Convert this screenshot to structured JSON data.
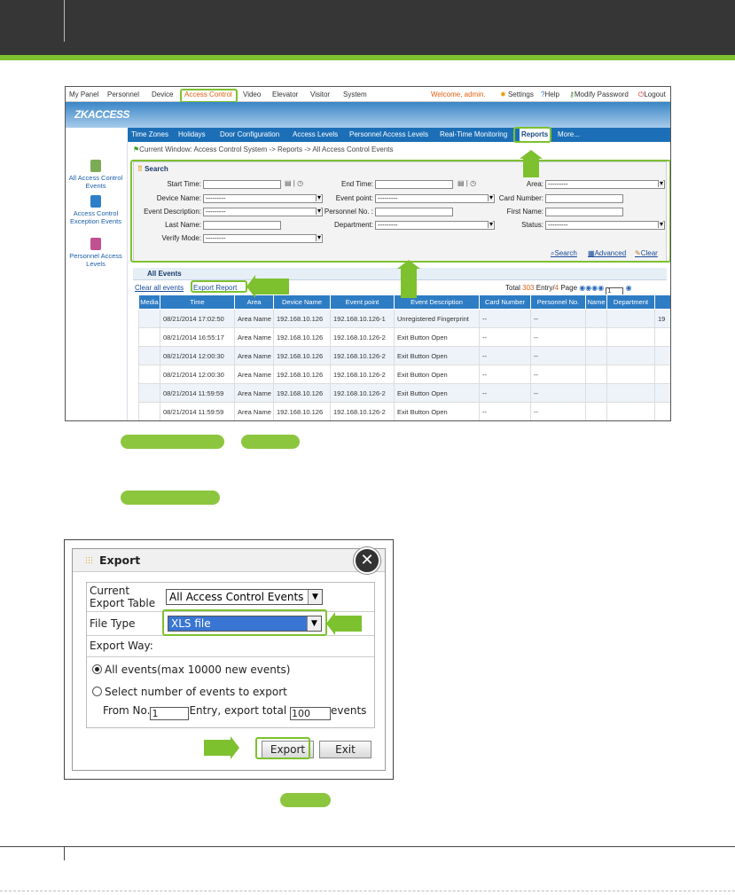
{
  "menubar": {
    "items": [
      "My Panel",
      "Personnel",
      "Device",
      "Access Control",
      "Video",
      "Elevator",
      "Visitor",
      "System"
    ],
    "welcome": "Welcome, admin.",
    "settings": "Settings",
    "help": "Help",
    "modify_password": "Modify Password",
    "logout": "Logout"
  },
  "logo": "ZKACCESS",
  "subnav": [
    "Time Zones",
    "Holidays",
    "Door Configuration",
    "Access Levels",
    "Personnel Access Levels",
    "Real-Time Monitoring",
    "Reports",
    "More..."
  ],
  "leftnav": [
    "All Access Control Events",
    "Access Control Exception Events",
    "Personnel Access Levels"
  ],
  "breadcrumb": "Current Window: Access Control System -> Reports -> All Access Control Events",
  "search": {
    "title": "Search",
    "start_time": "Start Time:",
    "end_time": "End Time:",
    "area": "Area:",
    "area_val": "---------",
    "device_name": "Device Name:",
    "device_val": "---------",
    "event_point": "Event point:",
    "event_point_val": "---------",
    "card_number": "Card Number:",
    "event_description": "Event Description:",
    "event_description_val": "---------",
    "personnel_no": "Personnel No. :",
    "first_name": "First Name:",
    "last_name": "Last Name:",
    "department": "Department:",
    "department_val": "---------",
    "status": "Status:",
    "status_val": "---------",
    "verify_mode": "Verify Mode:",
    "verify_val": "---------",
    "search_link": "Search",
    "advanced_link": "Advanced",
    "clear_link": "Clear"
  },
  "events": {
    "title": "All Events",
    "clear_all": "Clear all events",
    "export_report": "Export Report",
    "total_prefix": "Total",
    "total": "303",
    "entry_text": "Entry/",
    "pages": "4",
    "page_text": "Page",
    "page_no": "1",
    "columns": [
      "Media",
      "Time",
      "Area",
      "Device Name",
      "Event point",
      "Event Description",
      "Card Number",
      "Personnel No.",
      "Name",
      "Department",
      ""
    ],
    "rows": [
      [
        "",
        "08/21/2014 17:02:50",
        "Area Name",
        "192.168.10.126",
        "192.168.10.126-1",
        "Unregistered Fingerprint",
        "--",
        "--",
        "",
        "",
        "19"
      ],
      [
        "",
        "08/21/2014 16:55:17",
        "Area Name",
        "192.168.10.126",
        "192.168.10.126-2",
        "Exit Button Open",
        "--",
        "--",
        "",
        "",
        ""
      ],
      [
        "",
        "08/21/2014 12:00:30",
        "Area Name",
        "192.168.10.126",
        "192.168.10.126-2",
        "Exit Button Open",
        "--",
        "--",
        "",
        "",
        ""
      ],
      [
        "",
        "08/21/2014 12:00:30",
        "Area Name",
        "192.168.10.126",
        "192.168.10.126-2",
        "Exit Button Open",
        "--",
        "--",
        "",
        "",
        ""
      ],
      [
        "",
        "08/21/2014 11:59:59",
        "Area Name",
        "192.168.10.126",
        "192.168.10.126-2",
        "Exit Button Open",
        "--",
        "--",
        "",
        "",
        ""
      ],
      [
        "",
        "08/21/2014 11:59:59",
        "Area Name",
        "192.168.10.126",
        "192.168.10.126-2",
        "Exit Button Open",
        "--",
        "--",
        "",
        "",
        ""
      ]
    ]
  },
  "export_dialog": {
    "title": "Export",
    "current_table_label": "Current Export Table",
    "current_table_value": "All Access Control Events",
    "file_type_label": "File Type",
    "file_type_value": "XLS file",
    "export_way": "Export Way:",
    "option_all": "All events(max 10000 new events)",
    "option_select": "Select number of events to export",
    "from_no": "From No.",
    "from_val": "1",
    "entry_export_total": "Entry, export total",
    "total_val": "100",
    "events": "events",
    "export_button": "Export",
    "exit_button": "Exit"
  },
  "colors": {
    "accent_green": "#7dc12f",
    "header_dark": "#363636",
    "ui_blue": "#1c6fb6",
    "menu_orange": "#e06010"
  }
}
